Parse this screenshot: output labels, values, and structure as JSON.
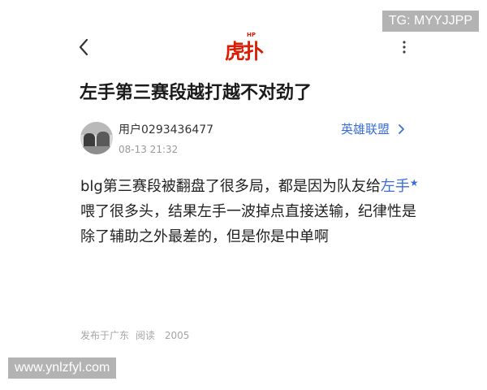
{
  "watermarks": {
    "top": "TG: MYYJJPP",
    "bottom": "www.ynlzfyl.com"
  },
  "top_bar": {
    "logo_text": "虎扑",
    "logo_super": "HP",
    "back_icon": "chevron-left-icon",
    "more_icon": "vertical-dots-icon"
  },
  "post": {
    "title": "左手第三赛段越打越不对劲了",
    "author": {
      "username": "用户0293436477",
      "time": "08-13 21:32"
    },
    "forum": {
      "label": "英雄联盟",
      "icon": "chevron-right-icon"
    },
    "body": {
      "part1": "blg第三赛段被翻盘了很多局，都是因为队友给",
      "hero_link": "左手",
      "hero_star": "★",
      "part2": "喂了很多头，结果左手一波掉点直接送输，纪律性是除了辅助之外最差的，但是你是中单啊"
    },
    "meta": {
      "location": "发布于广东",
      "read_label": "阅读",
      "read_count": "2005"
    }
  },
  "colors": {
    "link": "#3a6ed8",
    "logo": "#d81e06",
    "muted": "#999999",
    "title": "#1a1a1a"
  }
}
